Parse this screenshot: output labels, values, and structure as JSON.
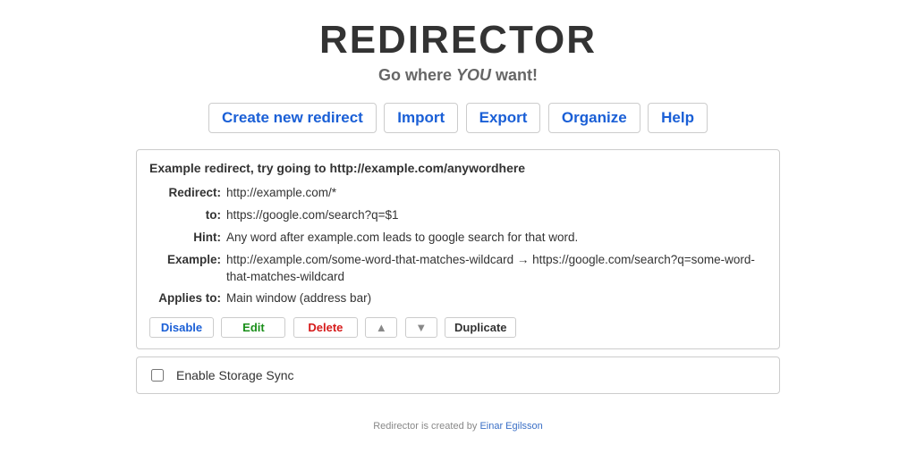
{
  "header": {
    "title": "REDIRECTOR",
    "subtitle_pre": "Go where ",
    "subtitle_em": "YOU",
    "subtitle_post": " want!"
  },
  "toolbar": {
    "create": "Create new redirect",
    "import": "Import",
    "export": "Export",
    "organize": "Organize",
    "help": "Help"
  },
  "redirect": {
    "title": "Example redirect, try going to http://example.com/anywordhere",
    "fields": {
      "redirect_label": "Redirect:",
      "redirect_value": "http://example.com/*",
      "to_label": "to:",
      "to_value": "https://google.com/search?q=$1",
      "hint_label": "Hint:",
      "hint_value": "Any word after example.com leads to google search for that word.",
      "example_label": "Example:",
      "example_value": "http://example.com/some-word-that-matches-wildcard  →  https://google.com/search?q=some-word-that-matches-wildcard",
      "applies_label": "Applies to:",
      "applies_value": "Main window (address bar)"
    },
    "actions": {
      "disable": "Disable",
      "edit": "Edit",
      "delete": "Delete",
      "up": "▲",
      "down": "▼",
      "duplicate": "Duplicate"
    }
  },
  "sync": {
    "label": "Enable Storage Sync"
  },
  "footer": {
    "text": "Redirector is created by ",
    "author": "Einar Egilsson"
  }
}
